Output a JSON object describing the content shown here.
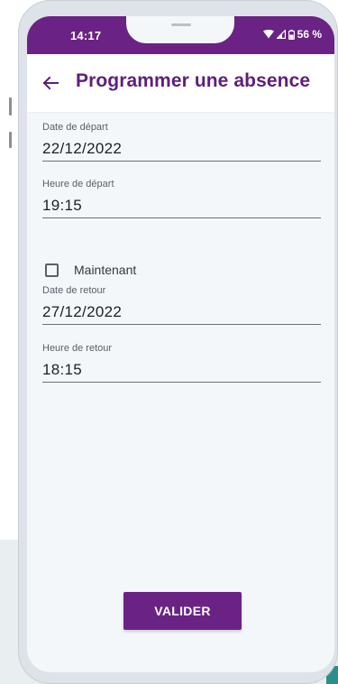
{
  "status_bar": {
    "time": "14:17",
    "battery": "56 %",
    "icons": [
      "wifi-icon",
      "signal-icon",
      "battery-icon"
    ]
  },
  "app_bar": {
    "back_icon": "arrow-left-icon",
    "title": "Programmer une absence"
  },
  "form": {
    "departure_date": {
      "label": "Date de départ",
      "value": "22/12/2022"
    },
    "departure_time": {
      "label": "Heure de départ",
      "value": "19:15"
    },
    "now_checkbox": {
      "label": "Maintenant",
      "checked": false
    },
    "return_date": {
      "label": "Date de retour",
      "value": "27/12/2022"
    },
    "return_time": {
      "label": "Heure de retour",
      "value": "18:15"
    }
  },
  "actions": {
    "validate_label": "VALIDER"
  },
  "colors": {
    "primary": "#6a2384",
    "title": "#5f1f78",
    "screen_background": "#f4f7fa"
  }
}
